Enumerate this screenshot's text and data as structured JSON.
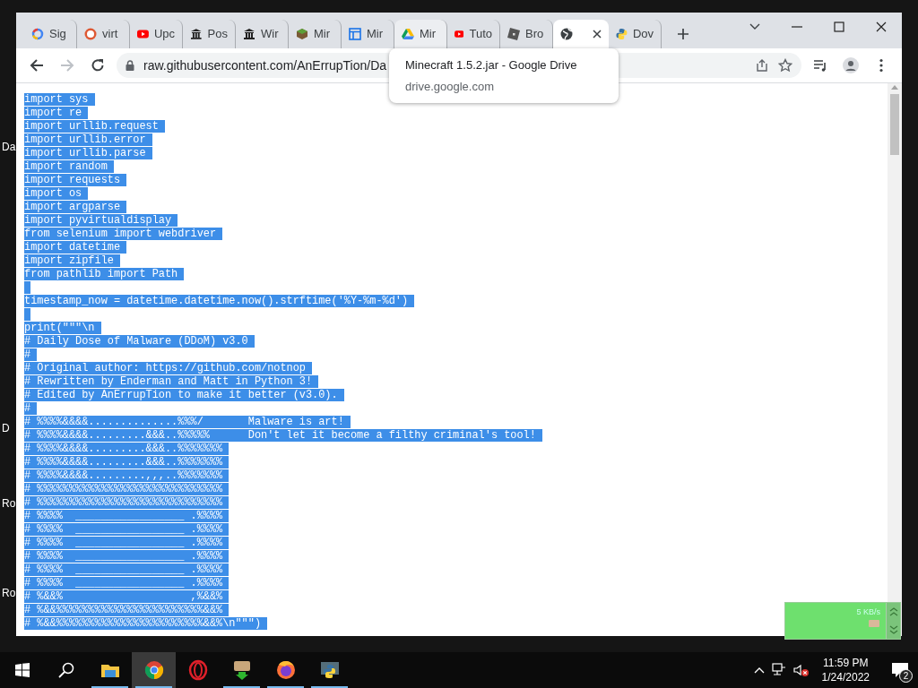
{
  "desktop_labels": [
    "Da",
    "D",
    "Ro",
    "Ro"
  ],
  "tabs": [
    {
      "label": "Sig",
      "selected": false,
      "hovered": false
    },
    {
      "label": "virt",
      "selected": false,
      "hovered": false
    },
    {
      "label": "Upc",
      "selected": false,
      "hovered": false
    },
    {
      "label": "Pos",
      "selected": false,
      "hovered": false
    },
    {
      "label": "Wir",
      "selected": false,
      "hovered": false
    },
    {
      "label": "Mir",
      "selected": false,
      "hovered": false
    },
    {
      "label": "Mir",
      "selected": false,
      "hovered": false
    },
    {
      "label": "Mir",
      "selected": false,
      "hovered": true
    },
    {
      "label": "Tuto",
      "selected": false,
      "hovered": false
    },
    {
      "label": "Bro",
      "selected": false,
      "hovered": false
    },
    {
      "selected": true,
      "hovered": false
    },
    {
      "label": "Dov",
      "selected": false,
      "hovered": false
    }
  ],
  "toolbar": {
    "back_disabled": false,
    "forward_disabled": true,
    "url": "raw.githubusercontent.com/AnErrupTion/Da"
  },
  "tooltip": {
    "title": "Minecraft 1.5.2.jar - Google Drive",
    "url": "drive.google.com"
  },
  "code_lines": [
    {
      "kind": "code",
      "text": "import sys",
      "selected": true
    },
    {
      "kind": "code",
      "text": "import re",
      "selected": true
    },
    {
      "kind": "code",
      "text": "import urllib.request",
      "selected": true
    },
    {
      "kind": "code",
      "text": "import urllib.error",
      "selected": true
    },
    {
      "kind": "code",
      "text": "import urllib.parse",
      "selected": true
    },
    {
      "kind": "code",
      "text": "import random",
      "selected": true
    },
    {
      "kind": "code",
      "text": "import requests",
      "selected": true
    },
    {
      "kind": "code",
      "text": "import os",
      "selected": true
    },
    {
      "kind": "code",
      "text": "import argparse",
      "selected": true
    },
    {
      "kind": "code",
      "text": "import pyvirtualdisplay",
      "selected": true
    },
    {
      "kind": "code",
      "text": "from selenium import webdriver",
      "selected": true
    },
    {
      "kind": "code",
      "text": "import datetime",
      "selected": true
    },
    {
      "kind": "code",
      "text": "import zipfile",
      "selected": true
    },
    {
      "kind": "code",
      "text": "from pathlib import Path",
      "selected": true
    },
    {
      "kind": "blank",
      "selected": true
    },
    {
      "kind": "code",
      "text": "timestamp_now = datetime.datetime.now().strftime('%Y-%m-%d')",
      "selected": true
    },
    {
      "kind": "blank",
      "selected": true
    },
    {
      "kind": "code",
      "text": "print(\"\"\"\\n",
      "selected": true
    },
    {
      "kind": "code",
      "text": "# Daily Dose of Malware (DDoM) v3.0",
      "selected": true
    },
    {
      "kind": "code",
      "text": "#",
      "selected": true
    },
    {
      "kind": "code",
      "text": "# Original author: https://github.com/notnop",
      "selected": true
    },
    {
      "kind": "code",
      "text": "# Rewritten by Enderman and Matt in Python 3!",
      "selected": true
    },
    {
      "kind": "code",
      "text": "# Edited by AnErrupTion to make it better (v3.0).",
      "selected": true
    },
    {
      "kind": "code",
      "text": "#",
      "selected": true
    },
    {
      "kind": "code",
      "text": "# %%%%&&&&..............%%%/       Malware is art!",
      "selected": true
    },
    {
      "kind": "code",
      "text": "# %%%%&&&&.........&&&..%%%%%      Don't let it become a filthy criminal's tool!",
      "selected": true
    },
    {
      "kind": "code",
      "text": "# %%%%&&&&.........&&&..%%%%%%%",
      "selected": true
    },
    {
      "kind": "code",
      "text": "# %%%%&&&&.........&&&..%%%%%%%",
      "selected": true
    },
    {
      "kind": "code",
      "text": "# %%%%&&&&.........,,,..%%%%%%%",
      "selected": true
    },
    {
      "kind": "code",
      "text": "# %%%%%%%%%%%%%%%%%%%%%%%%%%%%%",
      "selected": true
    },
    {
      "kind": "code",
      "text": "# %%%%%%%%%%%%%%%%%%%%%%%%%%%%%",
      "selected": true
    },
    {
      "kind": "code",
      "text": "# %%%%  _________________ .%%%%",
      "selected": true
    },
    {
      "kind": "code",
      "text": "# %%%%  _________________ .%%%%",
      "selected": true
    },
    {
      "kind": "code",
      "text": "# %%%%  _________________ .%%%%",
      "selected": true
    },
    {
      "kind": "code",
      "text": "# %%%%  _________________ .%%%%",
      "selected": true
    },
    {
      "kind": "code",
      "text": "# %%%%  _________________ .%%%%",
      "selected": true
    },
    {
      "kind": "code",
      "text": "# %%%%  _________________ .%%%%",
      "selected": true
    },
    {
      "kind": "code",
      "text": "# %&&%                    ,%&&%",
      "selected": true
    },
    {
      "kind": "code",
      "text": "# %&&%%%%%%%%%%%%%%%%%%%%%%%&&%",
      "selected": true
    },
    {
      "kind": "code",
      "text": "# %&&%%%%%%%%%%%%%%%%%%%%%%%&&%\\n\"\"\")",
      "selected": true
    }
  ],
  "net_meter": {
    "speed": "5 KB/s"
  },
  "taskbar": {
    "apps": [
      {
        "running": true,
        "active": false
      },
      {
        "running": true,
        "active": true
      },
      {
        "running": false,
        "active": false
      },
      {
        "running": true,
        "active": false
      },
      {
        "running": true,
        "active": false
      },
      {
        "running": true,
        "active": false
      }
    ],
    "volume_muted": true,
    "time": "11:59 PM",
    "date": "1/24/2022",
    "notifications": "2"
  }
}
